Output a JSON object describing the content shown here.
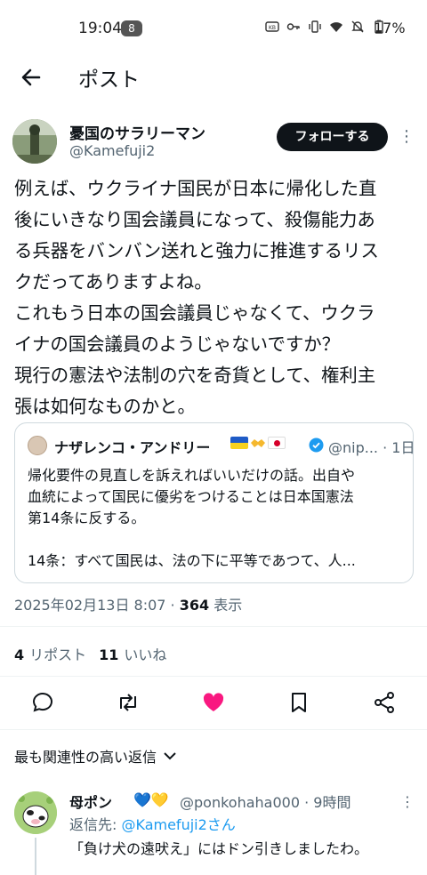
{
  "status_bar": {
    "time": "19:04",
    "notif_count": "8",
    "battery": "17%",
    "icons": [
      "network-speed-icon",
      "key-icon",
      "vibrate-icon",
      "wifi-icon",
      "mute-icon",
      "battery-icon"
    ]
  },
  "header": {
    "title": "ポスト",
    "back_icon": "arrow-left-icon"
  },
  "post": {
    "author_name": "憂国のサラリーマン",
    "author_handle": "@Kamefuji2",
    "follow_label": "フォローする",
    "body_lines": [
      "例えば、ウクライナ国民が日本に帰化した直",
      "後にいきなり国会議員になって、殺傷能力あ",
      "る兵器をバンバン送れと強力に推進するリス",
      "クだってありますよね。",
      "これもう日本の国会議員じゃなくて、ウクラ",
      "イナの国会議員のようじゃないですか？",
      "現行の憲法や法制の穴を奇貨として、権利主",
      "張は如何なものかと。"
    ],
    "quote": {
      "name": "ナザレンコ・アンドリー",
      "handle_time": "@nip... · 1日",
      "lines": [
        "帰化要件の見直しを訴えればいいだけの話。出自や",
        "血統によって国民に優劣をつけることは日本国憲法",
        "第14条に反する。",
        "",
        "14条：すべて国民は、法の下に平等であつて、人..."
      ]
    },
    "timestamp": "2025年02月13日 8:07 · ",
    "views_count": "364",
    "views_label": " 表示",
    "reposts_count": "4",
    "reposts_label": "リポスト",
    "likes_count": "11",
    "likes_label": "いいね"
  },
  "actions": {
    "reply_icon": "reply-icon",
    "repost_icon": "repost-icon",
    "like_icon": "heart-icon",
    "bookmark_icon": "bookmark-icon",
    "share_icon": "share-icon",
    "like_color": "#f91880"
  },
  "replies_sort": {
    "label": "最も関連性の高い返信"
  },
  "reply": {
    "name": "母ポン",
    "hearts": "💙💛",
    "handle_time": "@ponkohaha000 · 9時間",
    "to_prefix": "返信先: ",
    "to_handle": "@Kamefuji2さん",
    "text": "「負け犬の遠吠え」にはドン引きしましたわ。"
  }
}
